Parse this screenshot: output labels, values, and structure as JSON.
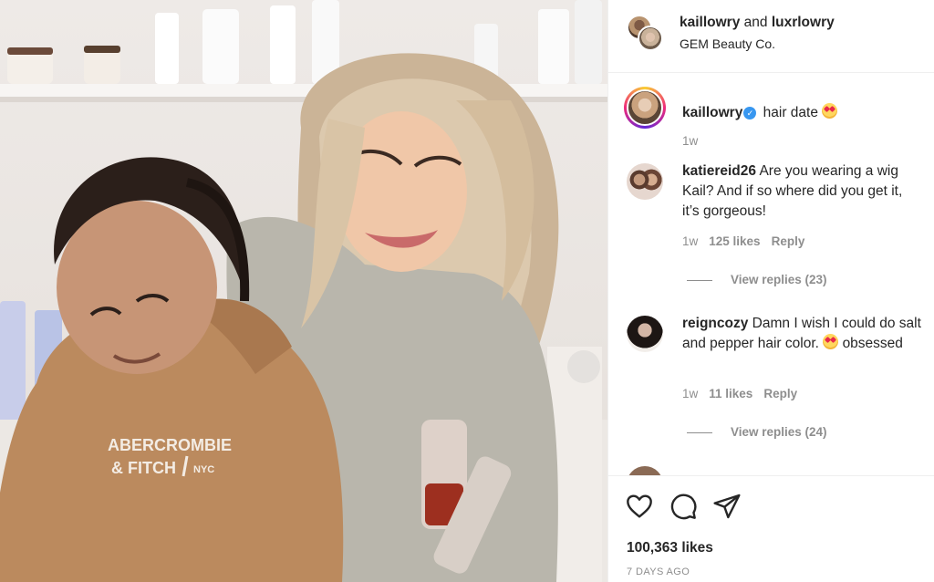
{
  "photo": {
    "sweatshirt_text_line1": "ABERCROMBIE",
    "sweatshirt_text_line2": "& FITCH",
    "sweatshirt_text_line3": "NYC"
  },
  "header": {
    "user1": "kaillowry",
    "joiner": " and ",
    "user2": "luxrlowry",
    "location": "GEM Beauty Co."
  },
  "caption": {
    "username": "kaillowry",
    "text": "hair date",
    "emoji": "heart-eyes-emoji",
    "time": "1w"
  },
  "comments": [
    {
      "username": "katiereid26",
      "text": "Are you wearing a wig Kail? And if so where did you get it, it’s gorgeous!",
      "time": "1w",
      "likes": "125 likes",
      "reply": "Reply",
      "view_replies": "View replies (23)"
    },
    {
      "username": "reigncozy",
      "text": "Damn I wish I could do salt and pepper hair color.",
      "text_after_emoji": "obsessed",
      "emoji": "heart-eyes-emoji",
      "time": "1w",
      "likes": "11 likes",
      "reply": "Reply",
      "view_replies": "View replies (24)"
    }
  ],
  "actions": {
    "icons": [
      "heart-icon",
      "comment-icon",
      "share-icon"
    ],
    "likes": "100,363 likes",
    "timestamp": "7 DAYS AGO"
  },
  "colors": {
    "text": "#262626",
    "muted": "#8e8e8e",
    "verified": "#3897f0",
    "divider": "#efefef"
  }
}
